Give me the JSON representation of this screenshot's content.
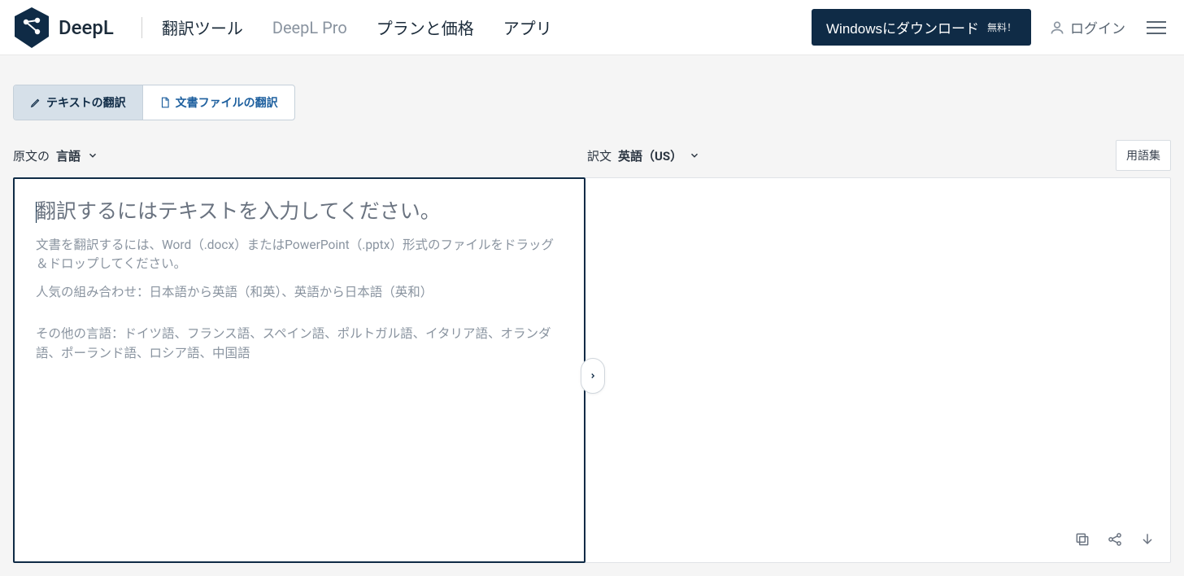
{
  "brand": {
    "name": "DeepL"
  },
  "nav": {
    "translator": "翻訳ツール",
    "pro": "DeepL Pro",
    "pricing": "プランと価格",
    "apps": "アプリ"
  },
  "header": {
    "download_label": "Windowsにダウンロード",
    "download_badge": "無料！",
    "login": "ログイン"
  },
  "mode_tabs": {
    "text": "テキストの翻訳",
    "document": "文書ファイルの翻訳"
  },
  "langbar": {
    "source_prefix": "原文の",
    "source_bold": "言語",
    "target_prefix": "訳文",
    "target_bold": "英語（US）",
    "glossary": "用語集"
  },
  "source_panel": {
    "placeholder_main": "翻訳するにはテキストを入力してください。",
    "placeholder_sub": "文書を翻訳するには、Word（.docx）またはPowerPoint（.pptx）形式のファイルをドラッグ＆ドロップしてください。",
    "popular_combos": "人気の組み合わせ：日本語から英語（和英）、英語から日本語（英和）",
    "other_langs": "その他の言語：ドイツ語、フランス語、スペイン語、ポルトガル語、イタリア語、オランダ語、ポーランド語、ロシア語、中国語"
  },
  "colors": {
    "brand_dark": "#0f2b46"
  }
}
